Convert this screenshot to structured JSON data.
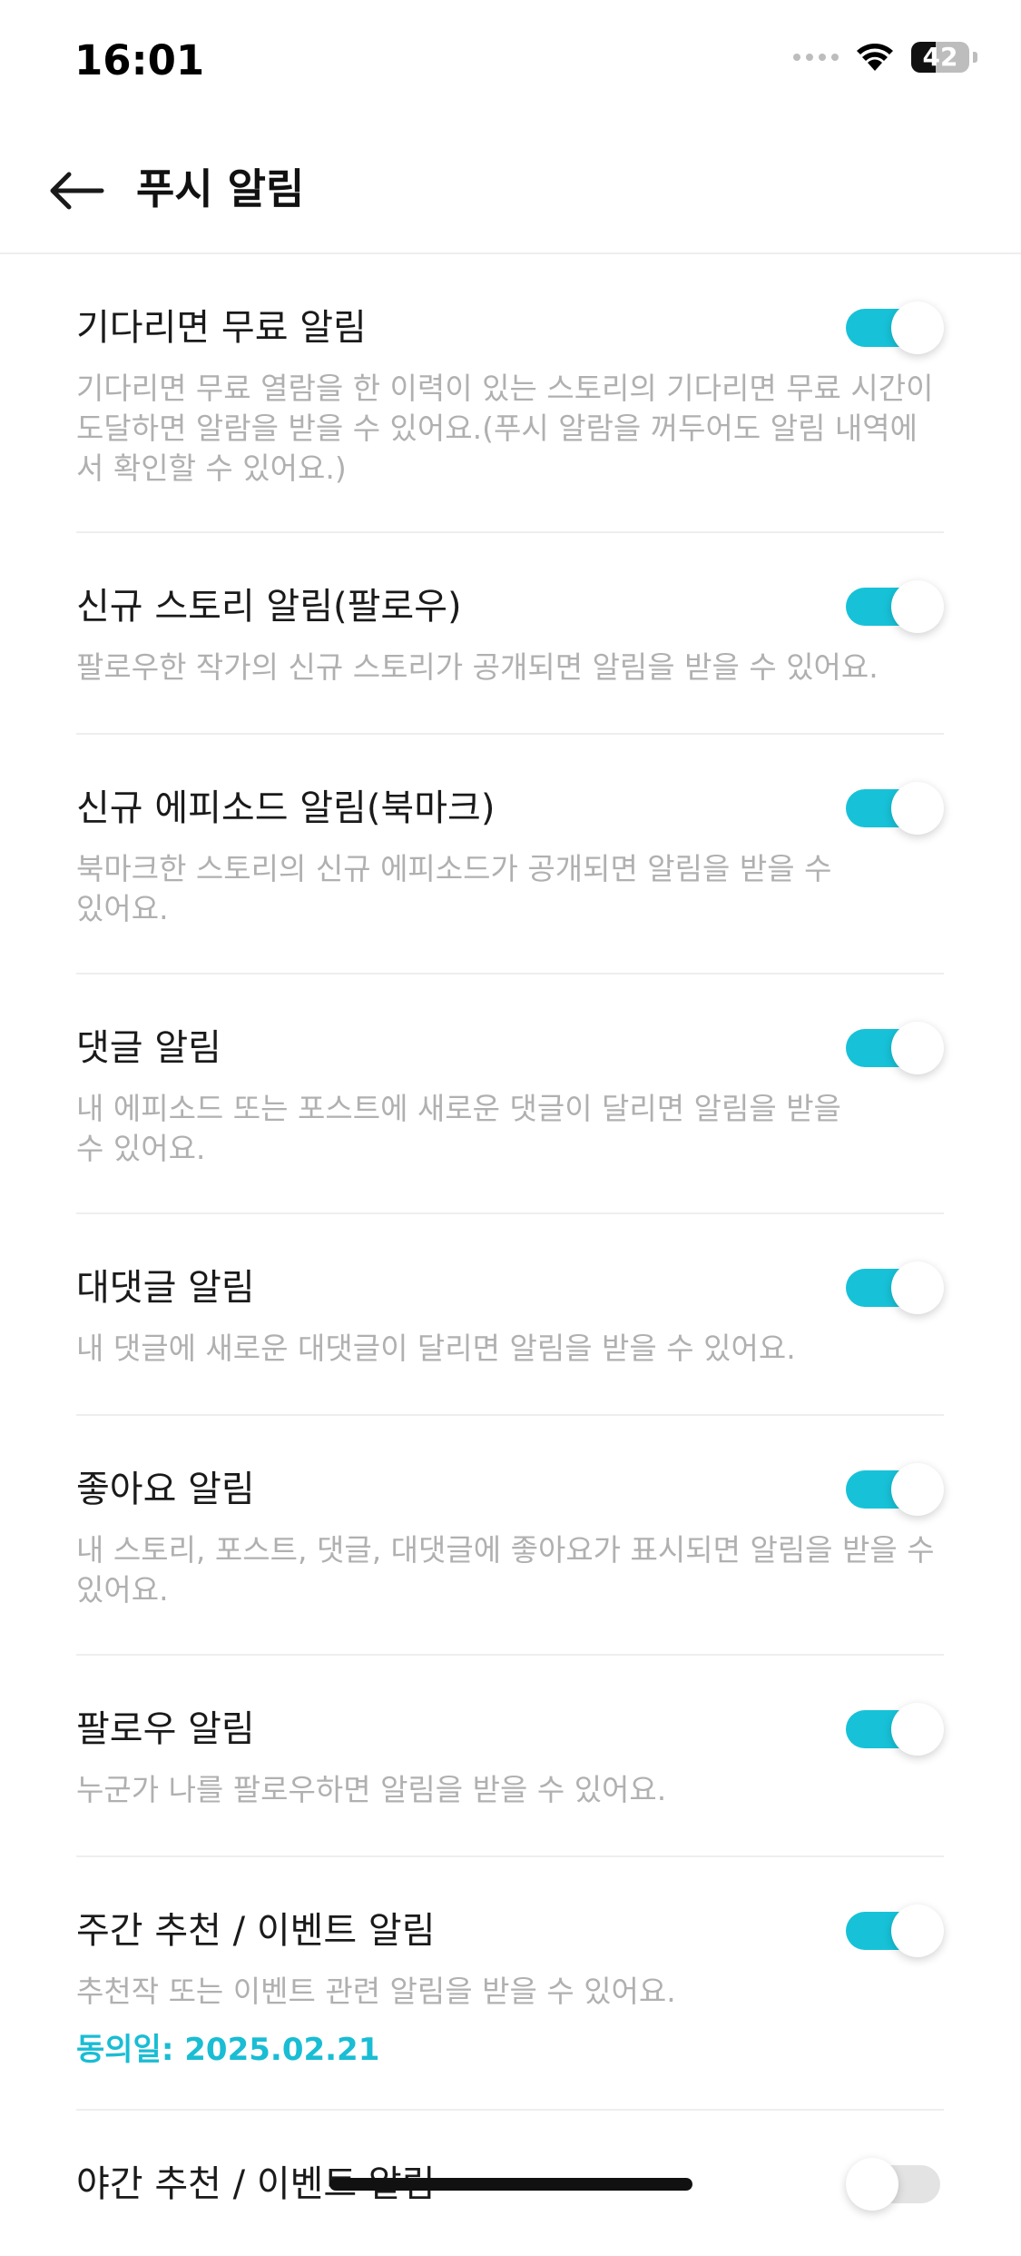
{
  "status_bar": {
    "time": "16:01",
    "battery": "42"
  },
  "header": {
    "title": "푸시 알림"
  },
  "items": [
    {
      "title": "기다리면 무료 알림",
      "desc": "기다리면 무료 열람을 한 이력이 있는 스토리의 기다리면 무료 시간이 도달하면 알람을 받을 수 있어요.(푸시 알람을 꺼두어도 알림 내역에서 확인할 수 있어요.)",
      "enabled": true
    },
    {
      "title": "신규 스토리 알림(팔로우)",
      "desc": "팔로우한 작가의 신규 스토리가 공개되면 알림을 받을 수 있어요.",
      "enabled": true
    },
    {
      "title": "신규 에피소드 알림(북마크)",
      "desc": "북마크한 스토리의 신규 에피소드가 공개되면 알림을 받을 수 있어요.",
      "enabled": true
    },
    {
      "title": "댓글 알림",
      "desc": "내 에피소드 또는 포스트에 새로운 댓글이 달리면 알림을 받을 수 있어요.",
      "enabled": true
    },
    {
      "title": "대댓글 알림",
      "desc": "내 댓글에 새로운 대댓글이 달리면 알림을 받을 수 있어요.",
      "enabled": true
    },
    {
      "title": "좋아요 알림",
      "desc": "내 스토리, 포스트, 댓글, 대댓글에 좋아요가 표시되면 알림을 받을 수 있어요.",
      "enabled": true
    },
    {
      "title": "팔로우 알림",
      "desc": "누군가 나를 팔로우하면 알림을 받을 수 있어요.",
      "enabled": true
    },
    {
      "title": "주간 추천 / 이벤트 알림",
      "desc": "추천작 또는 이벤트 관련 알림을 받을 수 있어요.",
      "agree": "동의일: 2025.02.21",
      "enabled": true
    },
    {
      "title": "야간 추천 / 이벤트 알림",
      "enabled": false
    }
  ],
  "colors": {
    "accent": "#17c2d8",
    "agree_text": "#19bdd4",
    "toggle_off": "#e3e3e3"
  }
}
